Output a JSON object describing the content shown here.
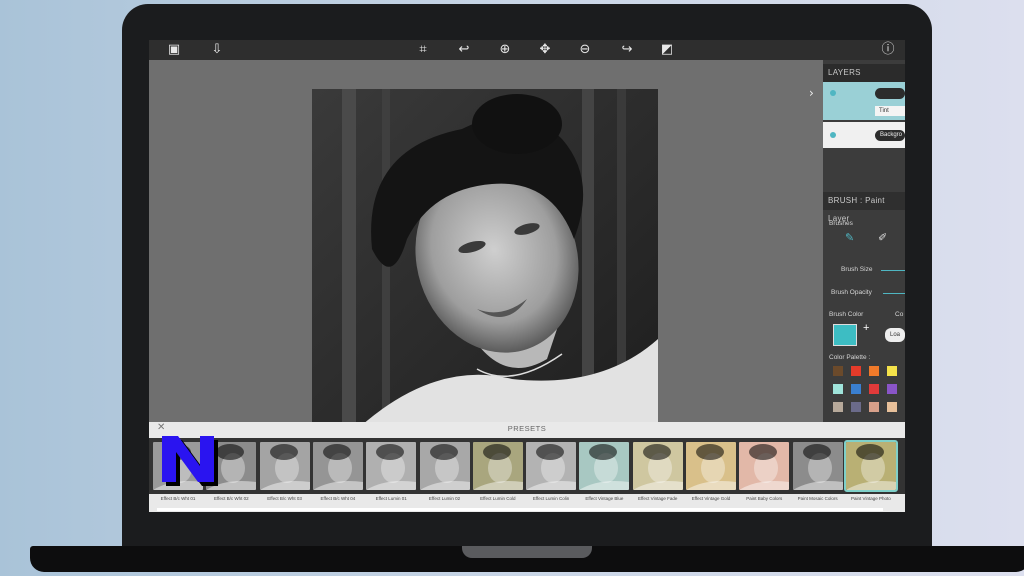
{
  "toolbar": {
    "icons": [
      "image-icon",
      "save-icon",
      "crop-icon",
      "rotate-icon",
      "zoom-in-icon",
      "move-icon",
      "zoom-out-icon",
      "redo-icon",
      "adjust-icon",
      "info-icon"
    ]
  },
  "layers": {
    "title": "LAYERS",
    "tint_label": "Tint",
    "background_label": "Backgro"
  },
  "brush": {
    "title": "BRUSH : Paint Layer",
    "brushes_label": "Brushes",
    "size_label": "Brush Size",
    "opacity_label": "Brush Opacity",
    "color_label": "Brush Color",
    "color_label2": "Co",
    "load_label": "Loa",
    "palette_label": "Color Palette :",
    "current_color": "#3dbdc3",
    "palette": [
      "#6b4a2b",
      "#e53b2a",
      "#f07a2a",
      "#f4e24a",
      "#e8d86a",
      "#9fe3da",
      "#3a7fd0",
      "#e13a3a",
      "#8a55c8",
      "#e98a8a",
      "#b7a99a",
      "#6b6b8a",
      "#d7a08a",
      "#e8c09a",
      "#f0c4b0"
    ]
  },
  "presets": {
    "title": "PRESETS",
    "items": [
      {
        "caption": "Effect B/c Wht 01",
        "tone": "#9a9a9a"
      },
      {
        "caption": "Effect B/c Wht 02",
        "tone": "#8c8c8c"
      },
      {
        "caption": "Effect B/c Wht 03",
        "tone": "#a4a4a4"
      },
      {
        "caption": "Effect B/c Wht 04",
        "tone": "#959595"
      },
      {
        "caption": "Effect Lumin 01",
        "tone": "#b0b0b0"
      },
      {
        "caption": "Effect Lumin 02",
        "tone": "#a8a8a8"
      },
      {
        "caption": "Effect Lumin Cold",
        "tone": "#a9a67e"
      },
      {
        "caption": "Effect Lumin Colin",
        "tone": "#b3b3b3"
      },
      {
        "caption": "Effect Vintage Blue",
        "tone": "#a8c8c2"
      },
      {
        "caption": "Effect Vintage Fade",
        "tone": "#cfc7a0"
      },
      {
        "caption": "Effect Vintage Gold",
        "tone": "#d9c08a"
      },
      {
        "caption": "Paint Baby Colors",
        "tone": "#e2b8a8"
      },
      {
        "caption": "Paint Mosaic Colors",
        "tone": "#8c8c8c"
      },
      {
        "caption": "Paint Vintage Photo",
        "tone": "#b9b074"
      }
    ]
  }
}
